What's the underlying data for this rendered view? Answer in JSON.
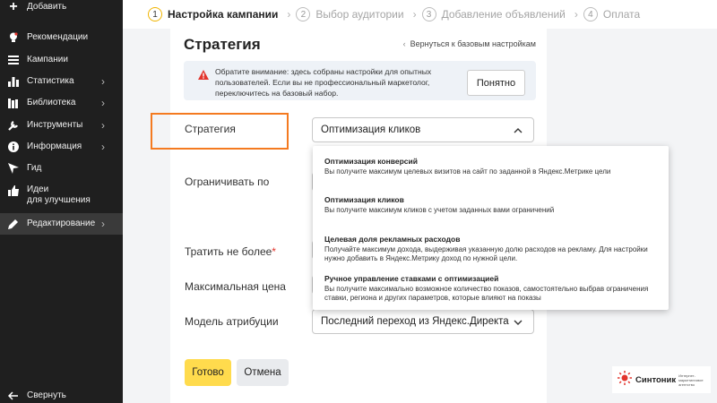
{
  "sidebar": {
    "items": [
      {
        "icon": "plus-icon",
        "label": "Добавить"
      },
      {
        "icon": "bulb-icon",
        "label": "Рекомендации"
      },
      {
        "icon": "list-icon",
        "label": "Кампании"
      },
      {
        "icon": "bar-chart-icon",
        "label": "Статистика"
      },
      {
        "icon": "library-icon",
        "label": "Библиотека"
      },
      {
        "icon": "wrench-icon",
        "label": "Инструменты"
      },
      {
        "icon": "info-icon",
        "label": "Информация"
      },
      {
        "icon": "guide-icon",
        "label": "Гид"
      },
      {
        "icon": "thumbs-up-icon",
        "label_line1": "Идеи",
        "label_line2": "для улучшения"
      },
      {
        "icon": "pencil-icon",
        "label": "Редактирование"
      }
    ],
    "collapse_label": "Свернуть"
  },
  "stepper": [
    {
      "num": "1",
      "label": "Настройка кампании"
    },
    {
      "num": "2",
      "label": "Выбор аудитории"
    },
    {
      "num": "3",
      "label": "Добавление объявлений"
    },
    {
      "num": "4",
      "label": "Оплата"
    }
  ],
  "panel": {
    "title": "Стратегия",
    "back_link": "Вернуться к базовым настройкам",
    "warning": {
      "text": "Обратите внимание: здесь собраны настройки для опытных пользователей. Если вы не профессиональный маркетолог, переключитесь на базовый набор.",
      "button": "Понятно"
    },
    "fields": {
      "strategy_label": "Стратегия",
      "strategy_value": "Оптимизация кликов",
      "limit_label": "Ограничивать по",
      "spend_label": "Тратить не более",
      "spend_required": "*",
      "max_price_label": "Максимальная цена",
      "attribution_label": "Модель атрибуции",
      "attribution_value": "Последний переход из Яндекс.Директа"
    },
    "buttons": {
      "done": "Готово",
      "cancel": "Отмена"
    }
  },
  "dropdown": {
    "options": [
      {
        "title": "Оптимизация конверсий",
        "desc": "Вы получите максимум целевых визитов на сайт по заданной в Яндекс.Метрике цели"
      },
      {
        "title": "Оптимизация кликов",
        "desc": "Вы получите максимум кликов с учетом заданных вами ограничений"
      },
      {
        "title": "Целевая доля рекламных расходов",
        "desc": "Получайте максимум дохода, выдерживая указанную долю расходов на рекламу. Для настройки нужно добавить в Яндекс.Метрику доход по нужной цели."
      },
      {
        "title": "Ручное управление ставками с оптимизацией",
        "desc": "Вы получите максимально возможное количество показов, самостоятельно выбрав ограничения ставки, региона и других параметров, которые влияют на показы"
      }
    ]
  },
  "logo": {
    "name": "Синтоник",
    "tagline": "Интернет-маркетинговое агентство"
  },
  "colors": {
    "accent_yellow": "#ffdb4d",
    "highlight_orange": "#f47a20",
    "warning_red": "#e2342c",
    "sidebar_bg": "#1f1f1f"
  }
}
